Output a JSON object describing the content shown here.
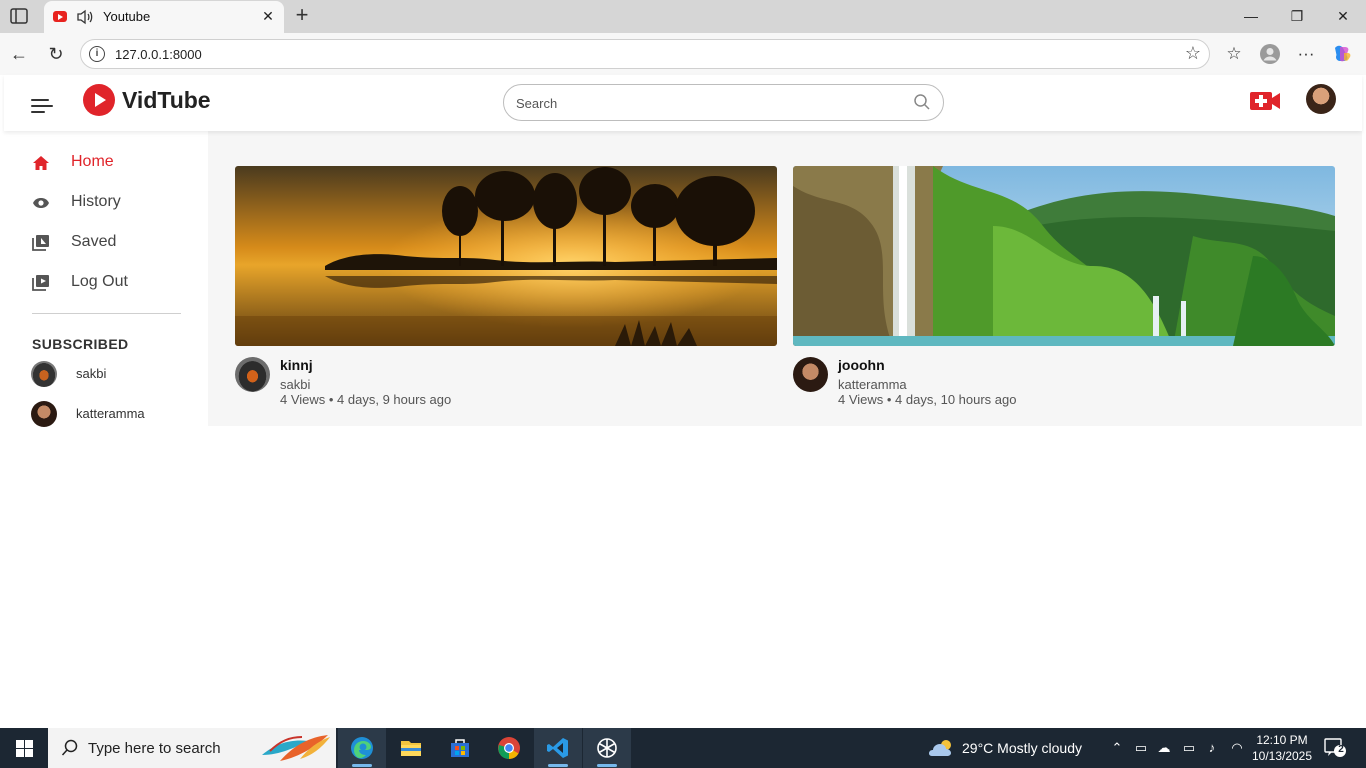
{
  "browser": {
    "tab_title": "Youtube",
    "url": "127.0.0.1:8000"
  },
  "app": {
    "logo": "VidTube",
    "search_placeholder": "Search",
    "accent_color": "#e0242a"
  },
  "sidebar": {
    "items": [
      {
        "label": "Home",
        "icon": "home-icon",
        "active": true
      },
      {
        "label": "History",
        "icon": "eye-icon",
        "active": false
      },
      {
        "label": "Saved",
        "icon": "library-icon",
        "active": false
      },
      {
        "label": "Log Out",
        "icon": "logout-icon",
        "active": false
      }
    ],
    "subscribed_title": "SUBSCRIBED",
    "subscriptions": [
      {
        "name": "sakbi"
      },
      {
        "name": "katteramma"
      }
    ]
  },
  "videos": [
    {
      "title": "kinnj",
      "channel": "sakbi",
      "meta": "4 Views • 4 days, 9 hours ago"
    },
    {
      "title": "jooohn",
      "channel": "katteramma",
      "meta": "4 Views • 4 days, 10 hours ago"
    }
  ],
  "taskbar": {
    "search_text": "Type here to search",
    "weather": "29°C  Mostly cloudy",
    "time": "12:10 PM",
    "date": "10/13/2025",
    "notifications": "2"
  }
}
